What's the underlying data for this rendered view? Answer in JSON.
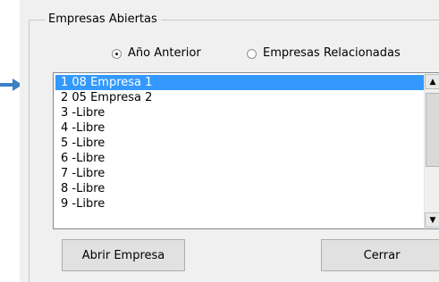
{
  "group": {
    "title": "Empresas Abiertas"
  },
  "options": {
    "prev_year": {
      "label": "Año Anterior",
      "checked": true
    },
    "related": {
      "label": "Empresas Relacionadas",
      "checked": false
    }
  },
  "list": {
    "items": [
      "1 08 Empresa 1",
      "2 05 Empresa 2",
      "3  -Libre",
      "4  -Libre",
      "5  -Libre",
      "6 -Libre",
      "7 -Libre",
      "8 -Libre",
      "9 -Libre"
    ],
    "selected_index": 0
  },
  "buttons": {
    "open_label": "Abrir Empresa",
    "close_label": "Cerrar"
  },
  "icons": {
    "pointer": "arrow-right-icon",
    "scroll_up": "triangle-up-icon",
    "scroll_down": "triangle-down-icon"
  },
  "colors": {
    "selection": "#3399ff",
    "pointer": "#3b7fc4",
    "dialog_bg": "#f0f0f0"
  }
}
